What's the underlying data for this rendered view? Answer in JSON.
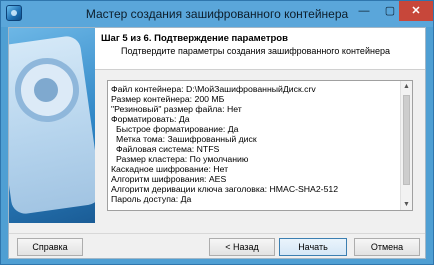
{
  "window": {
    "title": "Мастер создания зашифрованного контейнера",
    "minimize_glyph": "—",
    "maximize_glyph": "▢",
    "close_glyph": "✕"
  },
  "header": {
    "step_title": "Шаг 5 из 6. Подтверждение параметров",
    "step_subtitle": "Подтвердите параметры создания зашифрованного контейнера"
  },
  "details": {
    "lines": [
      "Файл контейнера: D:\\МойЗашифрованныйДиск.crv",
      "Размер контейнера: 200 МБ",
      "\"Резиновый\" размер файла: Нет",
      "Форматировать: Да",
      "  Быстрое форматирование: Да",
      "  Метка тома: Зашифрованный диск",
      "  Файловая система: NTFS",
      "  Размер кластера: По умолчанию",
      "Каскадное шифрование: Нет",
      "Алгоритм шифрования: AES",
      "Алгоритм деривации ключа заголовка: HMAC-SHA2-512",
      "Пароль доступа: Да"
    ]
  },
  "buttons": {
    "help": "Справка",
    "back": "< Назад",
    "start": "Начать",
    "cancel": "Отмена"
  },
  "scroll": {
    "up_glyph": "▲",
    "down_glyph": "▼"
  }
}
